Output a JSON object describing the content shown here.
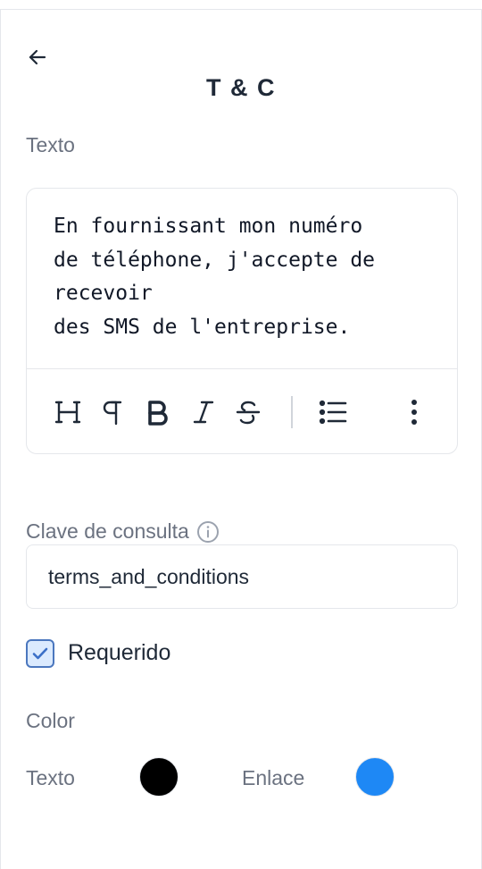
{
  "header": {
    "back_icon": "arrow-left-icon",
    "title": "T & C"
  },
  "text_section": {
    "label": "Texto",
    "content": "En fournissant mon numéro\nde téléphone, j'accepte de\nrecevoir\ndes SMS de l'entreprise.",
    "toolbar": [
      {
        "name": "heading",
        "icon": "heading-icon"
      },
      {
        "name": "paragraph",
        "icon": "paragraph-icon"
      },
      {
        "name": "bold",
        "icon": "bold-icon"
      },
      {
        "name": "italic",
        "icon": "italic-icon"
      },
      {
        "name": "strikethrough",
        "icon": "strikethrough-icon"
      },
      {
        "name": "bullet-list",
        "icon": "bullet-list-icon"
      },
      {
        "name": "more",
        "icon": "more-vertical-icon"
      }
    ]
  },
  "lookup_key": {
    "label": "Clave de consulta",
    "info_icon": "info-icon",
    "value": "terms_and_conditions"
  },
  "required": {
    "label": "Requerido",
    "checked": true
  },
  "color_section": {
    "label": "Color",
    "text_color_label": "Texto",
    "text_color": "#000000",
    "link_color_label": "Enlace",
    "link_color": "#1e88f5"
  }
}
